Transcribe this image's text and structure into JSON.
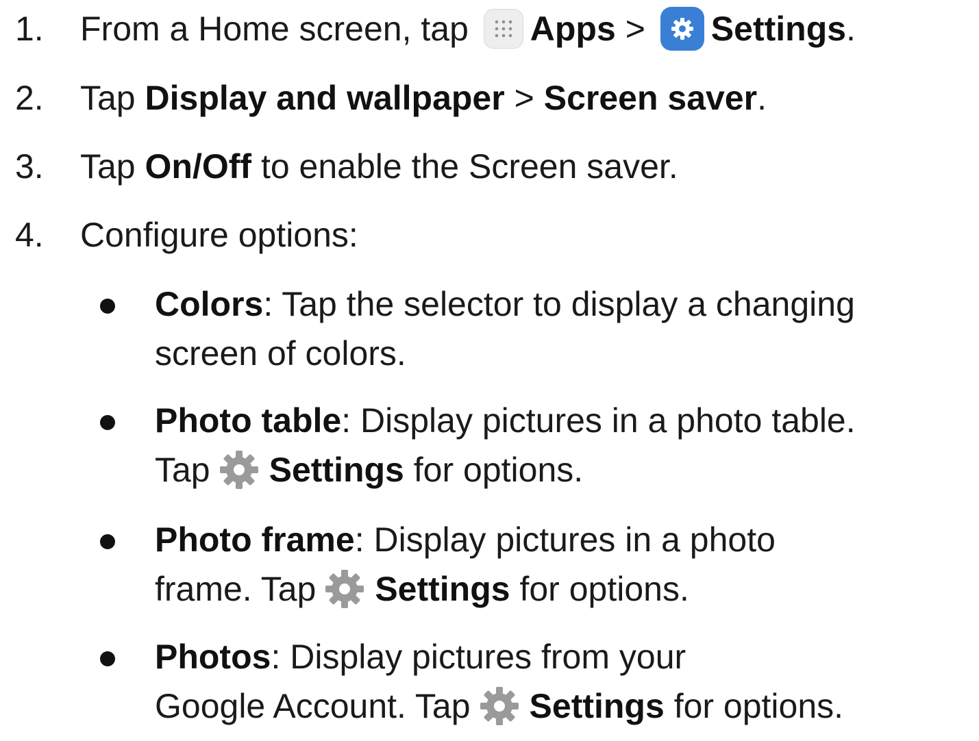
{
  "steps": [
    {
      "num": "1.",
      "pre": "From a Home screen, tap",
      "apps_label": "Apps",
      "sep": ">",
      "settings_label": "Settings",
      "end": "."
    },
    {
      "num": "2.",
      "pre": "Tap",
      "menu": "Display and wallpaper",
      "sep": ">",
      "item": "Screen saver",
      "end": "."
    },
    {
      "num": "3.",
      "pre": "Tap",
      "toggle": "On/Off",
      "post": "to enable the Screen saver."
    },
    {
      "num": "4.",
      "text": "Configure options:"
    }
  ],
  "options": [
    {
      "name": "Colors",
      "line1": ": Tap the selector to display a changing",
      "line2": "screen of colors."
    },
    {
      "name": "Photo table",
      "line1": ": Display pictures in a photo table.",
      "line2_pre": "Tap",
      "settings_label": "Settings",
      "line2_post": "for options."
    },
    {
      "name": "Photo frame",
      "line1": ": Display pictures in a photo",
      "line2_pre": "frame. Tap",
      "settings_label": "Settings",
      "line2_post": "for options."
    },
    {
      "name": "Photos",
      "line1": ": Display pictures from your",
      "line2_pre": "Google Account. Tap",
      "settings_label": "Settings",
      "line2_post": "for options."
    }
  ],
  "icons": {
    "apps": "apps-icon",
    "settings_app": "settings-app-icon",
    "gear": "gear-icon"
  },
  "colors": {
    "text": "#1a1a1a",
    "settings_blue": "#3a7fd6",
    "gear_gray": "#9a9a9a",
    "apps_bg": "#eeeeee"
  }
}
